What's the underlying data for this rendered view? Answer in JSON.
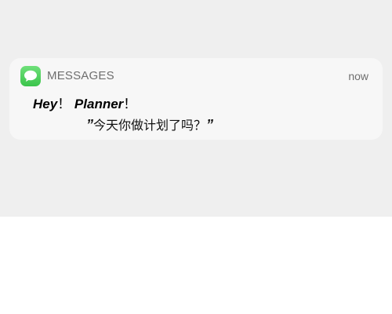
{
  "notification": {
    "app_name": "MESSAGES",
    "time": "now",
    "title_part1": "Hey",
    "title_sep1": "！",
    "title_part2": "Planner",
    "title_sep2": "！",
    "quote_open": "”",
    "message": "今天你做计划了吗？",
    "quote_close": "”"
  },
  "icons": {
    "app_icon": "messages-icon"
  },
  "colors": {
    "icon_green": "#3bc44b",
    "background": "#efefef",
    "card": "#f7f7f7"
  }
}
